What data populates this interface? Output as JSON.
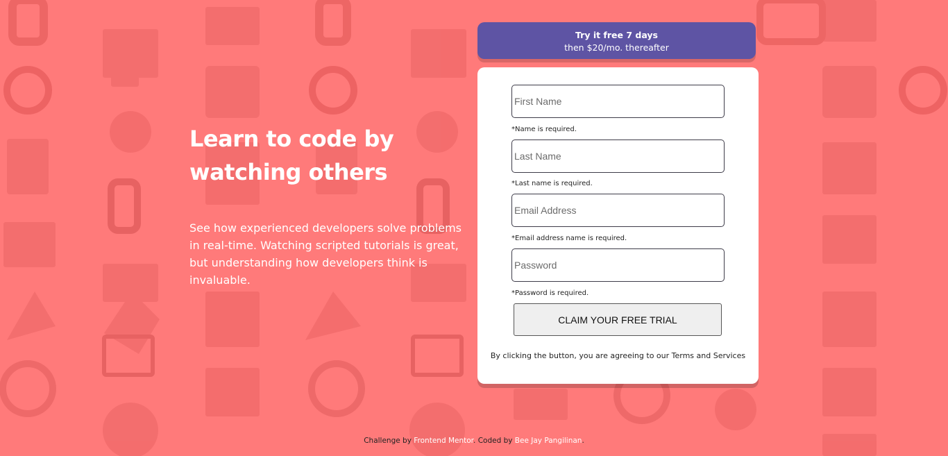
{
  "hero": {
    "title_line1": "Learn to code by",
    "title_line2": "watching others",
    "description": "See how experienced developers solve problems in real-time. Watching scripted tutorials is great, but understanding how developers think is invaluable."
  },
  "banner": {
    "bold": "Try it free 7 days",
    "rest": "then $20/mo. thereafter"
  },
  "form": {
    "first_name": {
      "placeholder": "First Name",
      "value": "",
      "error": "*Name is required."
    },
    "last_name": {
      "placeholder": "Last Name",
      "value": "",
      "error": "*Last name is required."
    },
    "email": {
      "placeholder": "Email Address",
      "value": "",
      "error": "*Email address name is required."
    },
    "password": {
      "placeholder": "Password",
      "value": "",
      "error": "*Password is required."
    },
    "submit_label": "CLAIM YOUR FREE TRIAL",
    "terms_prefix": "By clicking the button, you are agreeing to our ",
    "terms_link": "Terms and Services"
  },
  "footer": {
    "prefix": "Challenge by ",
    "link1": "Frontend Mentor",
    "middle": ". Coded by ",
    "link2": "Bee Jay Pangilinan",
    "suffix": "."
  },
  "colors": {
    "background": "#ff7a7a",
    "banner": "#5e54a4",
    "card": "#ffffff"
  }
}
